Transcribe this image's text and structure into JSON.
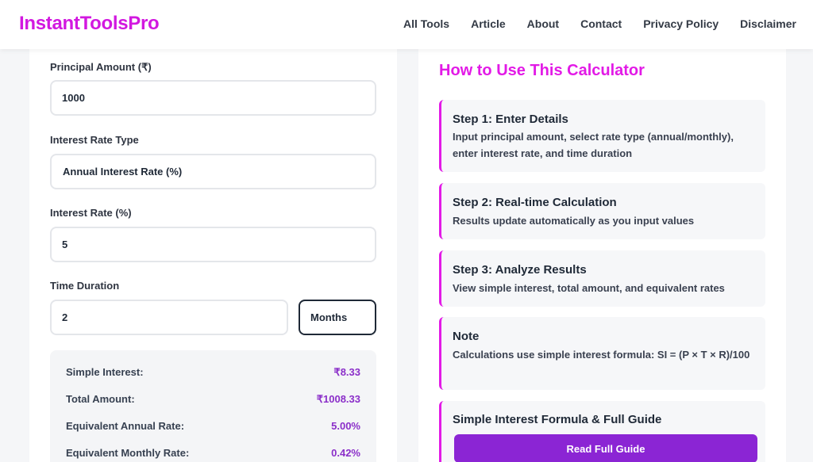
{
  "header": {
    "logo": "InstantToolsPro",
    "nav": [
      "All Tools",
      "Article",
      "About",
      "Contact",
      "Privacy Policy",
      "Disclaimer"
    ]
  },
  "calculator": {
    "principal": {
      "label": "Principal Amount (₹)",
      "value": "1000"
    },
    "rate_type": {
      "label": "Interest Rate Type",
      "selected": "Annual Interest Rate (%)"
    },
    "rate": {
      "label": "Interest Rate (%)",
      "value": "5"
    },
    "duration": {
      "label": "Time Duration",
      "value": "2",
      "unit": "Months"
    },
    "results": [
      {
        "label": "Simple Interest:",
        "value": "₹8.33"
      },
      {
        "label": "Total Amount:",
        "value": "₹1008.33"
      },
      {
        "label": "Equivalent Annual Rate:",
        "value": "5.00%"
      },
      {
        "label": "Equivalent Monthly Rate:",
        "value": "0.42%"
      }
    ]
  },
  "guide": {
    "title": "How to Use This Calculator",
    "steps": [
      {
        "title": "Step 1: Enter Details",
        "desc": "Input principal amount, select rate type (annual/monthly), enter interest rate, and time duration"
      },
      {
        "title": "Step 2: Real-time Calculation",
        "desc": "Results update automatically as you input values"
      },
      {
        "title": "Step 3: Analyze Results",
        "desc": "View simple interest, total amount, and equivalent rates"
      },
      {
        "title": "Note",
        "desc": "Calculations use simple interest formula: SI = (P × T × R)/100"
      }
    ],
    "formula_card": {
      "title": "Simple Interest Formula & Full Guide",
      "button": "Read Full Guide"
    }
  },
  "colors": {
    "brand_magenta": "#e21ae6",
    "button_purple": "#8b25d4",
    "result_value_purple": "#8b2fc9"
  }
}
